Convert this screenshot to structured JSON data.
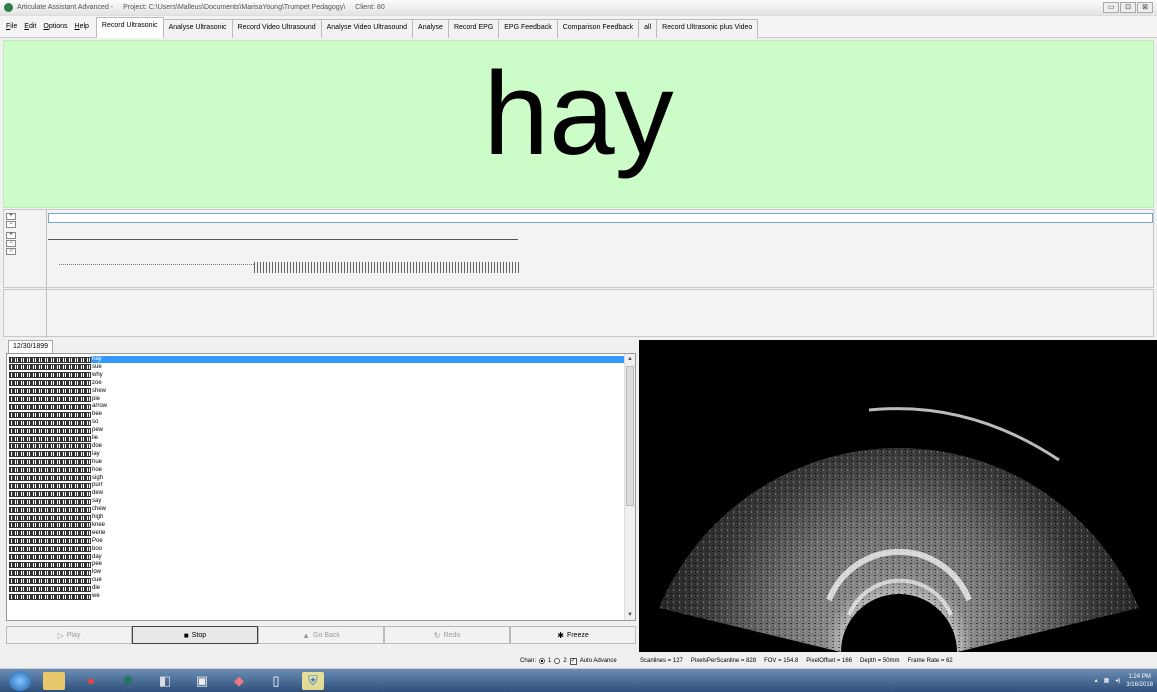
{
  "window": {
    "app_title": "Articulate Assistant Advanced -",
    "project": "Project: C:\\Users\\Malleus\\Documents\\MarisaYoung\\Trumpet Pedagogy\\",
    "client": "Client: 80",
    "controls": [
      "▭",
      "⊡",
      "⊠"
    ]
  },
  "menu": [
    "File",
    "Edit",
    "Options",
    "Help"
  ],
  "tabs": [
    "Record Ultrasonic",
    "Analyse Ultrasonic",
    "Record Video Ultrasound",
    "Analyse Video Ultrasound",
    "Analyse",
    "Record EPG",
    "EPG Feedback",
    "Comparison Feedback",
    "all",
    "Record Ultrasonic plus Video"
  ],
  "active_tab_index": 0,
  "prompt_word": "hay",
  "colors": {
    "prompt_bg": "#ccfcc8",
    "selection": "#3399ff"
  },
  "session_date": "12/30/1899",
  "word_list": [
    "hay",
    "sue",
    "why",
    "zoe",
    "shew",
    "pie",
    "arrow",
    "bee",
    "so",
    "pew",
    "lie",
    "doe",
    "lay",
    "hue",
    "hoe",
    "sigh",
    "purr",
    "dew",
    "say",
    "chew",
    "high",
    "knee",
    "eerie",
    "Poe",
    "boo",
    "day",
    "pee",
    "low",
    "cue",
    "die",
    "we"
  ],
  "selected_word_index": 0,
  "buttons": [
    {
      "label": "Play",
      "icon": "▷",
      "state": "disabled"
    },
    {
      "label": "Stop",
      "icon": "■",
      "state": "pressed"
    },
    {
      "label": "Go Back",
      "icon": "▲",
      "state": "disabled"
    },
    {
      "label": "Redo",
      "icon": "↻",
      "state": "disabled"
    },
    {
      "label": "Freeze",
      "icon": "✱",
      "state": "enabled"
    }
  ],
  "channel": {
    "label": "Chan:",
    "opt1": "1",
    "opt2": "2",
    "selected": "1",
    "auto_advance": "Auto Advance",
    "auto_advance_checked": true
  },
  "stats": [
    "Scanlines = 127",
    "PixelsPerScanline = 828",
    "FOV = 154.8",
    "PixelOffset = 166",
    "Depth = 50mm",
    "Frame Rate = 62"
  ],
  "clock": {
    "time": "1:24 PM",
    "date": "3/16/2018"
  }
}
